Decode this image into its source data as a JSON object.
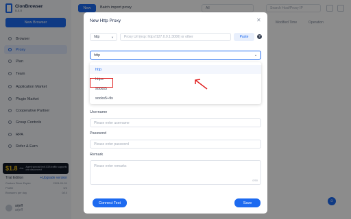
{
  "app": {
    "name": "ClonBrowser",
    "version": "5.4.0",
    "new_browser_label": "New Browser",
    "sidebar_items": [
      {
        "label": "Browser",
        "active": false
      },
      {
        "label": "Proxy",
        "active": true
      },
      {
        "label": "Plan",
        "active": false
      },
      {
        "label": "Team",
        "active": false
      },
      {
        "label": "Application Market",
        "active": false
      },
      {
        "label": "Plugin Market",
        "active": false
      },
      {
        "label": "Cooperative Partner",
        "active": false
      },
      {
        "label": "Group Controls",
        "active": false
      },
      {
        "label": "RPA",
        "active": false
      },
      {
        "label": "Refer & Earn",
        "active": false
      }
    ],
    "promo": {
      "price": "$1.8",
      "unit": "/mo",
      "text": "Agent special limit 2GB traffic supports one disconnect"
    },
    "trial": {
      "title": "Trial Edition",
      "upgrade_label": "+Upgrade version",
      "rows": [
        {
          "label": "Custom Store Expire",
          "value": "2024-01-01"
        },
        {
          "label": "Profile",
          "value": "0/2"
        },
        {
          "label": "Browsers per day",
          "value": "0/10"
        }
      ]
    },
    "user": {
      "name": "arjeff",
      "sub": "arjeff"
    }
  },
  "toolbar": {
    "new_label": "New",
    "batch_label": "Batch import proxy",
    "filter_value": "All",
    "search_placeholder": "Search Host/Proxy IP",
    "columns": [
      "Modified Time",
      "Operation"
    ]
  },
  "modal": {
    "title": "New Http Proxy",
    "type_value": "http",
    "proxy_placeholder": "Proxy Url (exp: http://127.0.0.1:3000) or other",
    "paste_label": "Paste",
    "selected_type": "http",
    "options": [
      "http",
      "https",
      "socks5",
      "socks5+tls"
    ],
    "username_label": "Username",
    "username_placeholder": "Please enter username",
    "password_label": "Password",
    "password_placeholder": "Please enter password",
    "remark_label": "Remark",
    "remark_placeholder": "Please enter remarks",
    "remark_counter": "0/50",
    "connect_label": "Connect Test",
    "save_label": "Save"
  },
  "colors": {
    "accent": "#1d6af0",
    "annotation": "#e02020"
  }
}
